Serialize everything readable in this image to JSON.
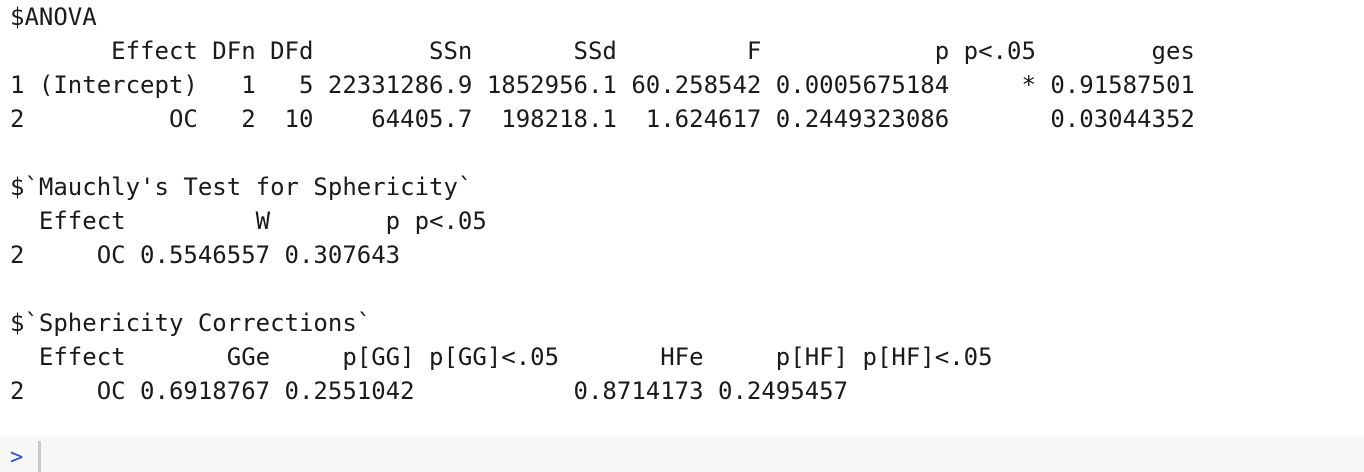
{
  "console": {
    "lines": [
      "$ANOVA",
      "       Effect DFn DFd        SSn       SSd         F            p p<.05        ges",
      "1 (Intercept)   1   5 22331286.9 1852956.1 60.258542 0.0005675184     * 0.91587501",
      "2          OC   2  10    64405.7  198218.1  1.624617 0.2449323086       0.03044352",
      "",
      "$`Mauchly's Test for Sphericity`",
      "  Effect         W        p p<.05",
      "2     OC 0.5546557 0.307643",
      "",
      "$`Sphericity Corrections`",
      "  Effect       GGe     p[GG] p[GG]<.05       HFe     p[HF] p[HF]<.05",
      "2     OC 0.6918767 0.2551042           0.8714173 0.2495457"
    ],
    "prompt_symbol": ">"
  },
  "colors": {
    "text": "#1a1a1a",
    "prompt": "#2b4fd6",
    "background": "#ffffff"
  }
}
